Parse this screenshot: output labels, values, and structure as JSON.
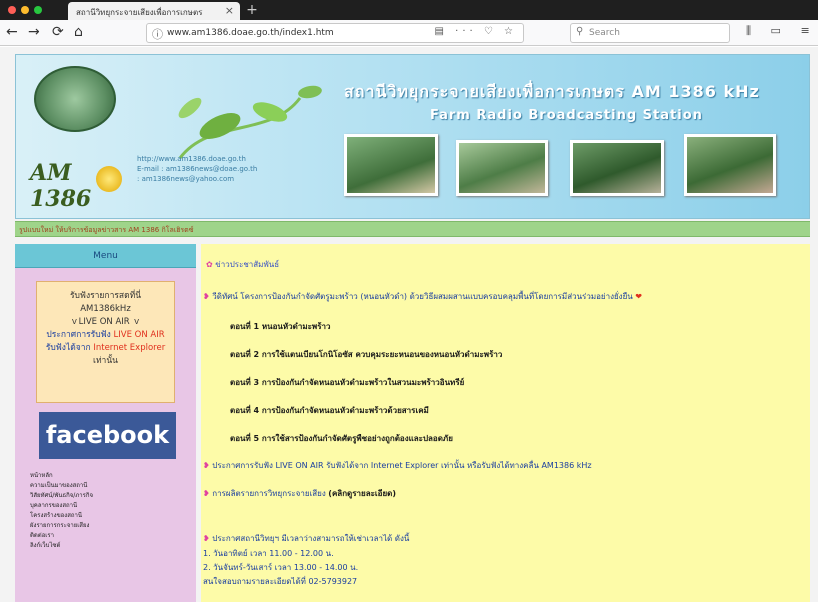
{
  "browser": {
    "tab_title": "สถานีวิทยุกระจายเสียงเพื่อการเกษตร",
    "tab_close": "×",
    "new_tab": "+",
    "url": "www.am1386.doae.go.th/index1.htm",
    "search_placeholder": "Search",
    "nav": {
      "back": "←",
      "forward": "→",
      "reload": "⟳",
      "home": "⌂"
    },
    "url_icons": "▤ ··· ♡ ☆",
    "right_icons": "⫼ ▭ ≡"
  },
  "header": {
    "station_th": "สถานีวิทยุกระจายเสียงเพื่อการเกษตร AM 1386 kHz",
    "station_en": "Farm Radio Broadcasting Station",
    "logo_text": "AM 1386",
    "contacts": [
      "http://www.am1386.doae.go.th",
      "E-mail : am1386news@doae.go.th",
      ": am1386news@yahoo.com"
    ]
  },
  "strip_text": "รูปแบบใหม่ ให้บริการข้อมูลข่าวสาร AM 1386 กิโลเฮิรตซ์",
  "sidebar": {
    "menu_label": "Menu",
    "live_box": {
      "line1": "รับฟังรายการสดที่นี่",
      "line2": "AM1386kHz",
      "line3": "LIVE ON AIR",
      "line4a": "ประกาศการรับฟัง",
      "line4b": "LIVE ON AIR",
      "line5a": "รับฟังได้จาก",
      "line5b": "Internet Explorer",
      "line6": "เท่านั้น"
    },
    "facebook_label": "facebook",
    "links": [
      "หน้าหลัก",
      "ความเป็นมาของสถานี",
      "วิสัยทัศน์/พันธกิจ/ภารกิจ",
      "บุคลากรของสถานี",
      "โครงสร้างของสถานี",
      "ผังรายการกระจายเสียง",
      "ติดต่อเรา",
      "ลิงก์เว็บไซต์"
    ]
  },
  "main": {
    "news_title": "ข่าวประชาสัมพันธ์",
    "line1": "วีดิทัศน์ โครงการป้องกันกำจัดศัตรูมะพร้าว (หนอนหัวดำ) ด้วยวิธีผสมผสานแบบครอบคลุมพื้นที่โดยการมีส่วนร่วมอย่างยั่งยืน",
    "episodes": [
      "ตอนที่ 1  หนอนหัวดำมะพร้าว",
      "ตอนที่ 2  การใช้แตนเบียนโกนิโอซัส ควบคุมระยะหนอนของหนอนหัวดำมะพร้าว",
      "ตอนที่ 3  การป้องกันกำจัดหนอนหัวดำมะพร้าวในสวนมะพร้าวอินทรีย์",
      "ตอนที่ 4  การป้องกันกำจัดหนอนหัวดำมะพร้าวด้วยสารเคมี",
      "ตอนที่ 5  การใช้สารป้องกันกำจัดศัตรูพืชอย่างถูกต้องและปลอดภัย"
    ],
    "live_line": "ประกาศการรับฟัง LIVE ON AIR รับฟังได้จาก Internet Explorer เท่านั้น หรือรับฟังได้ทางคลื่น AM1386 kHz",
    "program_line": "การผลิตรายการวิทยุกระจายเสียง",
    "program_link": "(คลิกดูรายละเอียด)",
    "announce": "ประกาศสถานีวิทยุฯ มีเวลาว่างสามารถให้เช่าเวลาได้ ดังนี้",
    "schedule": [
      "1. วันอาทิตย์ เวลา 11.00 - 12.00 น.",
      "2. วันจันทร์-วันเสาร์ เวลา 13.00 - 14.00 น.",
      "สนใจสอบถามรายละเอียดได้ที่ 02-5793927"
    ]
  }
}
